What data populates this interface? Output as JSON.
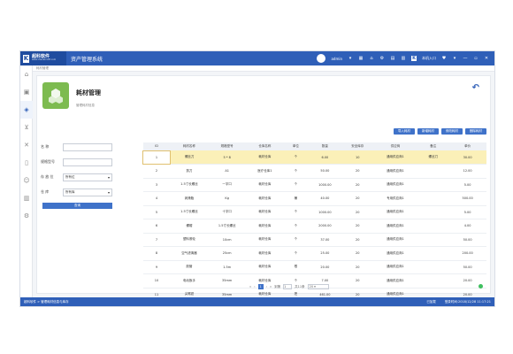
{
  "header": {
    "logo_mark": "K",
    "logo_cn": "超科软件",
    "logo_en": "www.chaoke soft.com",
    "app_title": "资产管理系统",
    "user": "admin",
    "k_label": "K",
    "right_label": "本机入口"
  },
  "crumb": "耗材管理",
  "page": {
    "title": "耗材管理",
    "subtitle": "管理耗材信息"
  },
  "actions": [
    "导入耗材",
    "新增耗材",
    "修改耗材",
    "删除耗材"
  ],
  "filters": {
    "name_label": "名 称",
    "model_label": "规格型号",
    "location_label": "存 放 位",
    "location_value": "所有位",
    "warehouse_label": "仓 库",
    "warehouse_value": "所有库",
    "query": "查询"
  },
  "table": {
    "columns": [
      "ID",
      "耗材名称",
      "规格型号",
      "仓库名称",
      "单位",
      "数量",
      "安全库存",
      "供应商",
      "备注",
      "单价"
    ],
    "rows": [
      [
        "1",
        "螺丝刀",
        "5 * 8",
        "耗材仓库",
        "个",
        "6.00",
        "10",
        "通用供应商1",
        "螺丝刀",
        "30.00"
      ],
      [
        "2",
        "剪刀",
        "A1",
        "医疗仓库1",
        "个",
        "50.00",
        "20",
        "通用供应商1",
        "",
        "12.00"
      ],
      [
        "3",
        "1.5寸长螺丝",
        "一字口",
        "耗材仓库",
        "个",
        "1000.00",
        "20",
        "通用供应商1",
        "",
        "5.00"
      ],
      [
        "4",
        "润滑脂",
        "Kg",
        "耗材仓库",
        "桶",
        "40.00",
        "20",
        "专用供应商1",
        "",
        "500.00"
      ],
      [
        "5",
        "1.5寸长螺丝",
        "十字口",
        "耗材仓库",
        "个",
        "1000.00",
        "20",
        "通用供应商1",
        "",
        "5.00"
      ],
      [
        "6",
        "螺帽",
        "1.5寸长螺丝",
        "耗材仓库",
        "个",
        "2000.00",
        "20",
        "通用供应商1",
        "",
        "4.00"
      ],
      [
        "7",
        "塑料滚轮",
        "10cm",
        "耗材仓库",
        "个",
        "37.00",
        "20",
        "通用供应商1",
        "",
        "50.00"
      ],
      [
        "8",
        "空气滤清器",
        "25cm",
        "耗材仓库",
        "个",
        "25.00",
        "20",
        "通用供应商1",
        "",
        "200.00"
      ],
      [
        "9",
        "胶管",
        "1.5m",
        "耗材仓库",
        "根",
        "20.00",
        "20",
        "通用供应商1",
        "",
        "50.00"
      ],
      [
        "10",
        "电动扳手",
        "35mm",
        "耗材仓库",
        "个",
        "7.00",
        "20",
        "通用供应商1",
        "",
        "20.00"
      ],
      [
        "11",
        "尖嘴钳",
        "35mm",
        "耗材仓库",
        "把",
        "461.00",
        "20",
        "通用供应商1",
        "",
        "20.00"
      ]
    ]
  },
  "pager": {
    "current": "1",
    "prefix": "到第",
    "page_box": "1",
    "suffix": "共11条",
    "size": "20"
  },
  "status": {
    "left": "超科软件 > 管理耗材信息与库存",
    "mid": "已加载",
    "right": "登录时间:2018/12/28 11:17:21"
  }
}
